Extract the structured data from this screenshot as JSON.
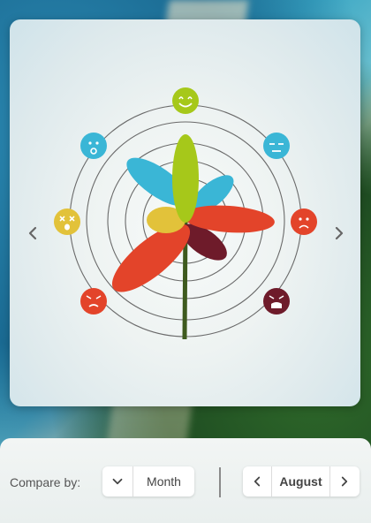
{
  "controls": {
    "compare_label": "Compare by:",
    "compare_value": "Month",
    "month_value": "August"
  },
  "colors": {
    "ring": "#6a6a6a",
    "stem": "#3e5a1e",
    "very_happy": "#a6c81a",
    "happy": "#3ab6d6",
    "neutral": "#e2c23a",
    "angry": "#e3442a",
    "very_angry": "#6e1b2a",
    "sad": "#e3442a"
  },
  "icons": {
    "prev": "chevron-left-icon",
    "next": "chevron-right-icon",
    "dropdown": "chevron-down-icon"
  },
  "chart_data": {
    "type": "radial-petal",
    "rings": 5,
    "moods": [
      {
        "name": "very-happy",
        "color": "#a6c81a",
        "value": 0.9
      },
      {
        "name": "happy",
        "color": "#3ab6d6",
        "value": 0.75
      },
      {
        "name": "calm",
        "color": "#3ab6d6",
        "value": 0.5
      },
      {
        "name": "sad",
        "color": "#e3442a",
        "value": 0.95
      },
      {
        "name": "very-angry",
        "color": "#6e1b2a",
        "value": 0.55
      },
      {
        "name": "angry",
        "color": "#e3442a",
        "value": 0.9
      },
      {
        "name": "neutral",
        "color": "#e2c23a",
        "value": 0.3
      }
    ]
  }
}
